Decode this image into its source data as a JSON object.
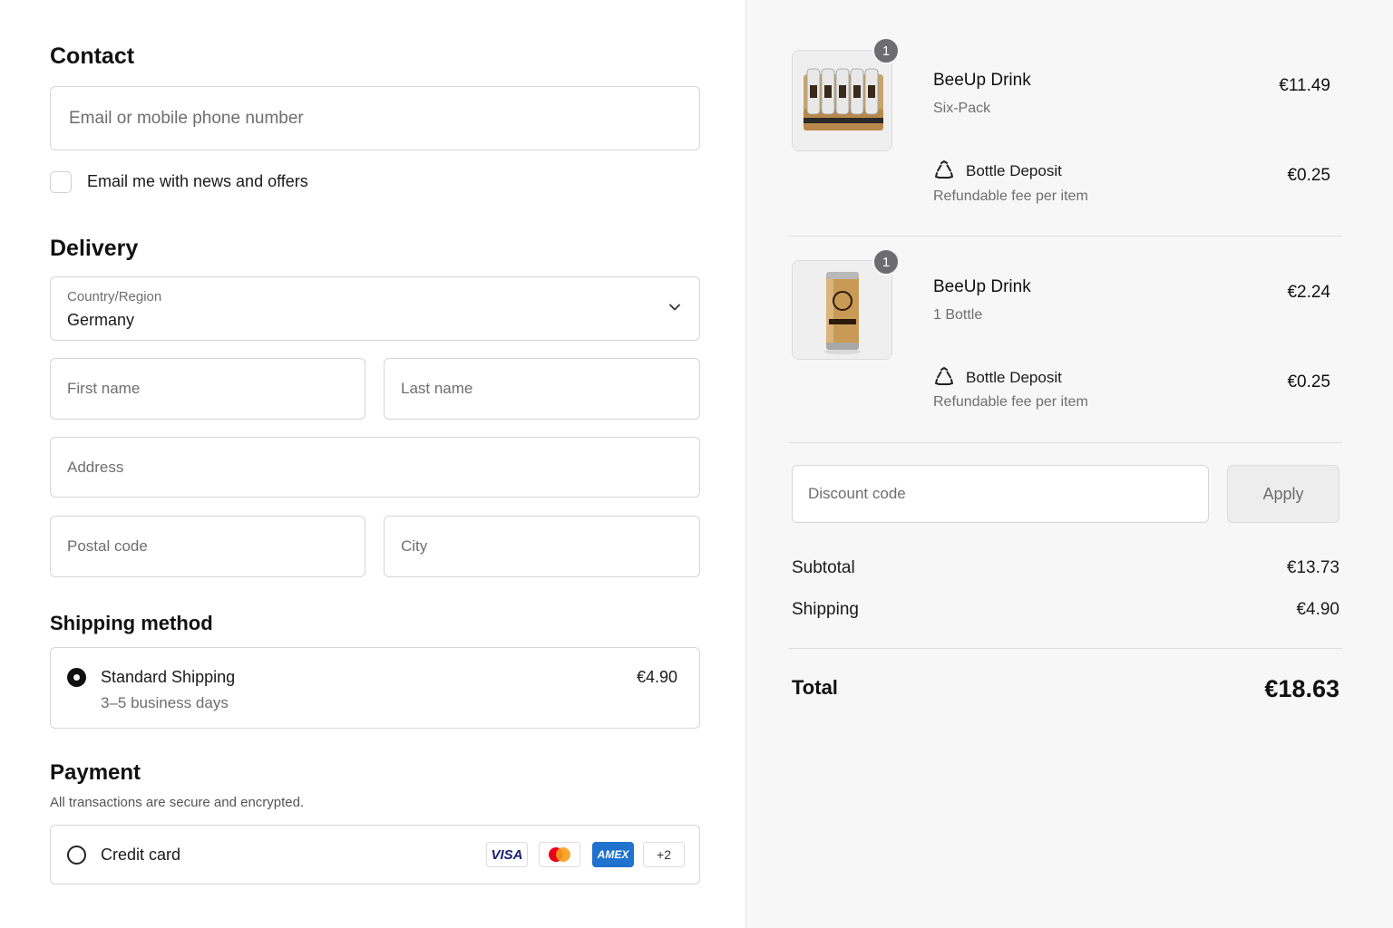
{
  "contact": {
    "title": "Contact",
    "email_placeholder": "Email or mobile phone number",
    "newsletter_label": "Email me with news and offers"
  },
  "delivery": {
    "title": "Delivery",
    "country_label": "Country/Region",
    "country_value": "Germany",
    "first_name_placeholder": "First name",
    "last_name_placeholder": "Last name",
    "address_placeholder": "Address",
    "postal_placeholder": "Postal code",
    "city_placeholder": "City"
  },
  "shipping": {
    "title": "Shipping method",
    "option_name": "Standard Shipping",
    "option_days": "3–5 business days",
    "option_price": "€4.90"
  },
  "payment": {
    "title": "Payment",
    "subtitle": "All transactions are secure and encrypted.",
    "option_label": "Credit card",
    "cards": [
      "VISA",
      "mastercard",
      "AMEX",
      "+2"
    ]
  },
  "order": {
    "items": [
      {
        "quantity": "1",
        "name": "BeeUp Drink",
        "variant": "Six-Pack",
        "price": "€11.49",
        "deposit_name": "Bottle Deposit",
        "deposit_sub": "Refundable fee per item",
        "deposit_price": "€0.25"
      },
      {
        "quantity": "1",
        "name": "BeeUp Drink",
        "variant": "1 Bottle",
        "price": "€2.24",
        "deposit_name": "Bottle Deposit",
        "deposit_sub": "Refundable fee per item",
        "deposit_price": "€0.25"
      }
    ],
    "discount_placeholder": "Discount code",
    "apply_label": "Apply",
    "subtotal_label": "Subtotal",
    "subtotal_value": "€13.73",
    "shipping_label": "Shipping",
    "shipping_value": "€4.90",
    "total_label": "Total",
    "total_value": "€18.63"
  },
  "colors": {
    "accent": "#111111",
    "panel_bg": "#f7f7f8",
    "visa_blue": "#1a1f71",
    "amex_blue": "#1f72cd"
  }
}
